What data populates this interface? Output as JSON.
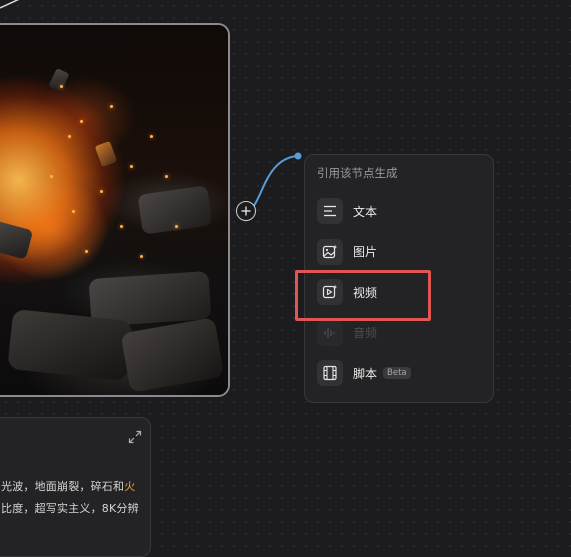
{
  "menu": {
    "header": "引用该节点生成",
    "items": [
      {
        "label": "文本",
        "icon": "text-lines-icon",
        "enabled": true
      },
      {
        "label": "图片",
        "icon": "image-sparkle-icon",
        "enabled": true
      },
      {
        "label": "视频",
        "icon": "video-sparkle-icon",
        "enabled": true
      },
      {
        "label": "音频",
        "icon": "audio-wave-icon",
        "enabled": false
      },
      {
        "label": "脚本",
        "icon": "film-strip-icon",
        "enabled": true,
        "badge": "Beta"
      }
    ]
  },
  "prompt": {
    "line1_main": "光波，地面崩裂，碎石和",
    "line1_highlight": "火",
    "line2": "比度，超写实主义，8K分辨"
  },
  "colors": {
    "canvas_bg": "#1c1c1e",
    "panel_bg": "#232325",
    "connector_blue": "#5b9bd5",
    "highlight_red": "#e25555",
    "accent_orange": "#e8a33a"
  }
}
